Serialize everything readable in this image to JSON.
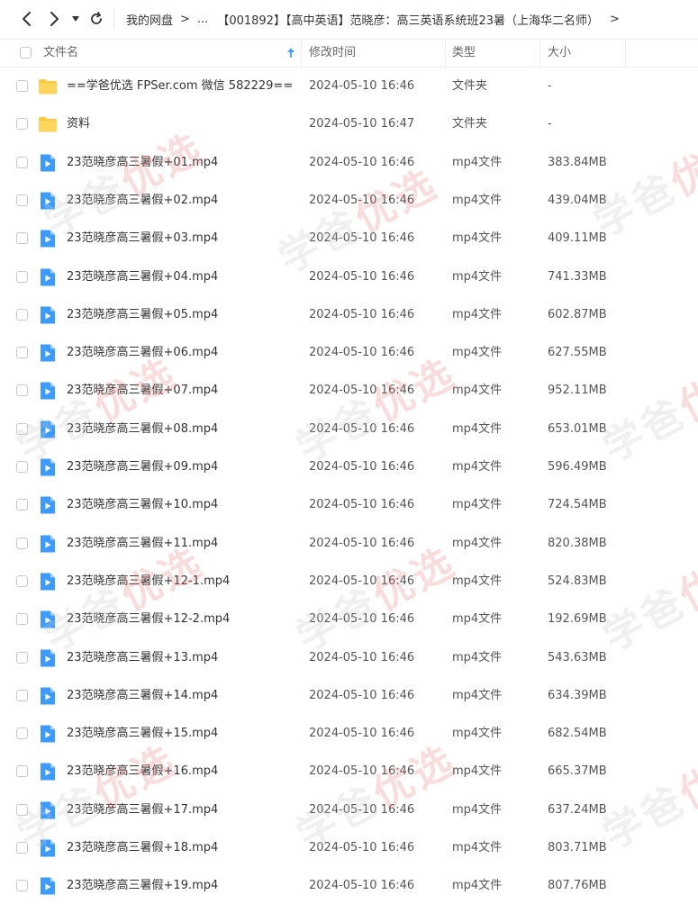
{
  "toolbar": {
    "breadcrumbs": [
      "我的网盘",
      "...",
      "【001892】【高中英语】范晓彦：高三英语系统班23暑（上海华二名师）"
    ]
  },
  "columns": {
    "name": "文件名",
    "modified": "修改时间",
    "type": "类型",
    "size": "大小"
  },
  "files": [
    {
      "name": "==学爸优选 FPSer.com 微信 582229==",
      "modified": "2024-05-10 16:46",
      "type": "文件夹",
      "size": "-",
      "icon": "folder-icon"
    },
    {
      "name": "资料",
      "modified": "2024-05-10 16:47",
      "type": "文件夹",
      "size": "-",
      "icon": "folder-icon"
    },
    {
      "name": "23范晓彦高三暑假+01.mp4",
      "modified": "2024-05-10 16:46",
      "type": "mp4文件",
      "size": "383.84MB",
      "icon": "video-file-icon"
    },
    {
      "name": "23范晓彦高三暑假+02.mp4",
      "modified": "2024-05-10 16:46",
      "type": "mp4文件",
      "size": "439.04MB",
      "icon": "video-file-icon"
    },
    {
      "name": "23范晓彦高三暑假+03.mp4",
      "modified": "2024-05-10 16:46",
      "type": "mp4文件",
      "size": "409.11MB",
      "icon": "video-file-icon"
    },
    {
      "name": "23范晓彦高三暑假+04.mp4",
      "modified": "2024-05-10 16:46",
      "type": "mp4文件",
      "size": "741.33MB",
      "icon": "video-file-icon"
    },
    {
      "name": "23范晓彦高三暑假+05.mp4",
      "modified": "2024-05-10 16:46",
      "type": "mp4文件",
      "size": "602.87MB",
      "icon": "video-file-icon"
    },
    {
      "name": "23范晓彦高三暑假+06.mp4",
      "modified": "2024-05-10 16:46",
      "type": "mp4文件",
      "size": "627.55MB",
      "icon": "video-file-icon"
    },
    {
      "name": "23范晓彦高三暑假+07.mp4",
      "modified": "2024-05-10 16:46",
      "type": "mp4文件",
      "size": "952.11MB",
      "icon": "video-file-icon"
    },
    {
      "name": "23范晓彦高三暑假+08.mp4",
      "modified": "2024-05-10 16:46",
      "type": "mp4文件",
      "size": "653.01MB",
      "icon": "video-file-icon"
    },
    {
      "name": "23范晓彦高三暑假+09.mp4",
      "modified": "2024-05-10 16:46",
      "type": "mp4文件",
      "size": "596.49MB",
      "icon": "video-file-icon"
    },
    {
      "name": "23范晓彦高三暑假+10.mp4",
      "modified": "2024-05-10 16:46",
      "type": "mp4文件",
      "size": "724.54MB",
      "icon": "video-file-icon"
    },
    {
      "name": "23范晓彦高三暑假+11.mp4",
      "modified": "2024-05-10 16:46",
      "type": "mp4文件",
      "size": "820.38MB",
      "icon": "video-file-icon"
    },
    {
      "name": "23范晓彦高三暑假+12-1.mp4",
      "modified": "2024-05-10 16:46",
      "type": "mp4文件",
      "size": "524.83MB",
      "icon": "video-file-icon"
    },
    {
      "name": "23范晓彦高三暑假+12-2.mp4",
      "modified": "2024-05-10 16:46",
      "type": "mp4文件",
      "size": "192.69MB",
      "icon": "video-file-icon"
    },
    {
      "name": "23范晓彦高三暑假+13.mp4",
      "modified": "2024-05-10 16:46",
      "type": "mp4文件",
      "size": "543.63MB",
      "icon": "video-file-icon"
    },
    {
      "name": "23范晓彦高三暑假+14.mp4",
      "modified": "2024-05-10 16:46",
      "type": "mp4文件",
      "size": "634.39MB",
      "icon": "video-file-icon"
    },
    {
      "name": "23范晓彦高三暑假+15.mp4",
      "modified": "2024-05-10 16:46",
      "type": "mp4文件",
      "size": "682.54MB",
      "icon": "video-file-icon"
    },
    {
      "name": "23范晓彦高三暑假+16.mp4",
      "modified": "2024-05-10 16:46",
      "type": "mp4文件",
      "size": "665.37MB",
      "icon": "video-file-icon"
    },
    {
      "name": "23范晓彦高三暑假+17.mp4",
      "modified": "2024-05-10 16:46",
      "type": "mp4文件",
      "size": "637.24MB",
      "icon": "video-file-icon"
    },
    {
      "name": "23范晓彦高三暑假+18.mp4",
      "modified": "2024-05-10 16:46",
      "type": "mp4文件",
      "size": "803.71MB",
      "icon": "video-file-icon"
    },
    {
      "name": "23范晓彦高三暑假+19.mp4",
      "modified": "2024-05-10 16:46",
      "type": "mp4文件",
      "size": "807.76MB",
      "icon": "video-file-icon"
    }
  ],
  "watermark": {
    "text_gray": "学爸",
    "text_red": "优选"
  },
  "colors": {
    "folder": "#FFC83D",
    "video_icon": "#3D9BFF",
    "sort_arrow": "#3D9BFF"
  }
}
